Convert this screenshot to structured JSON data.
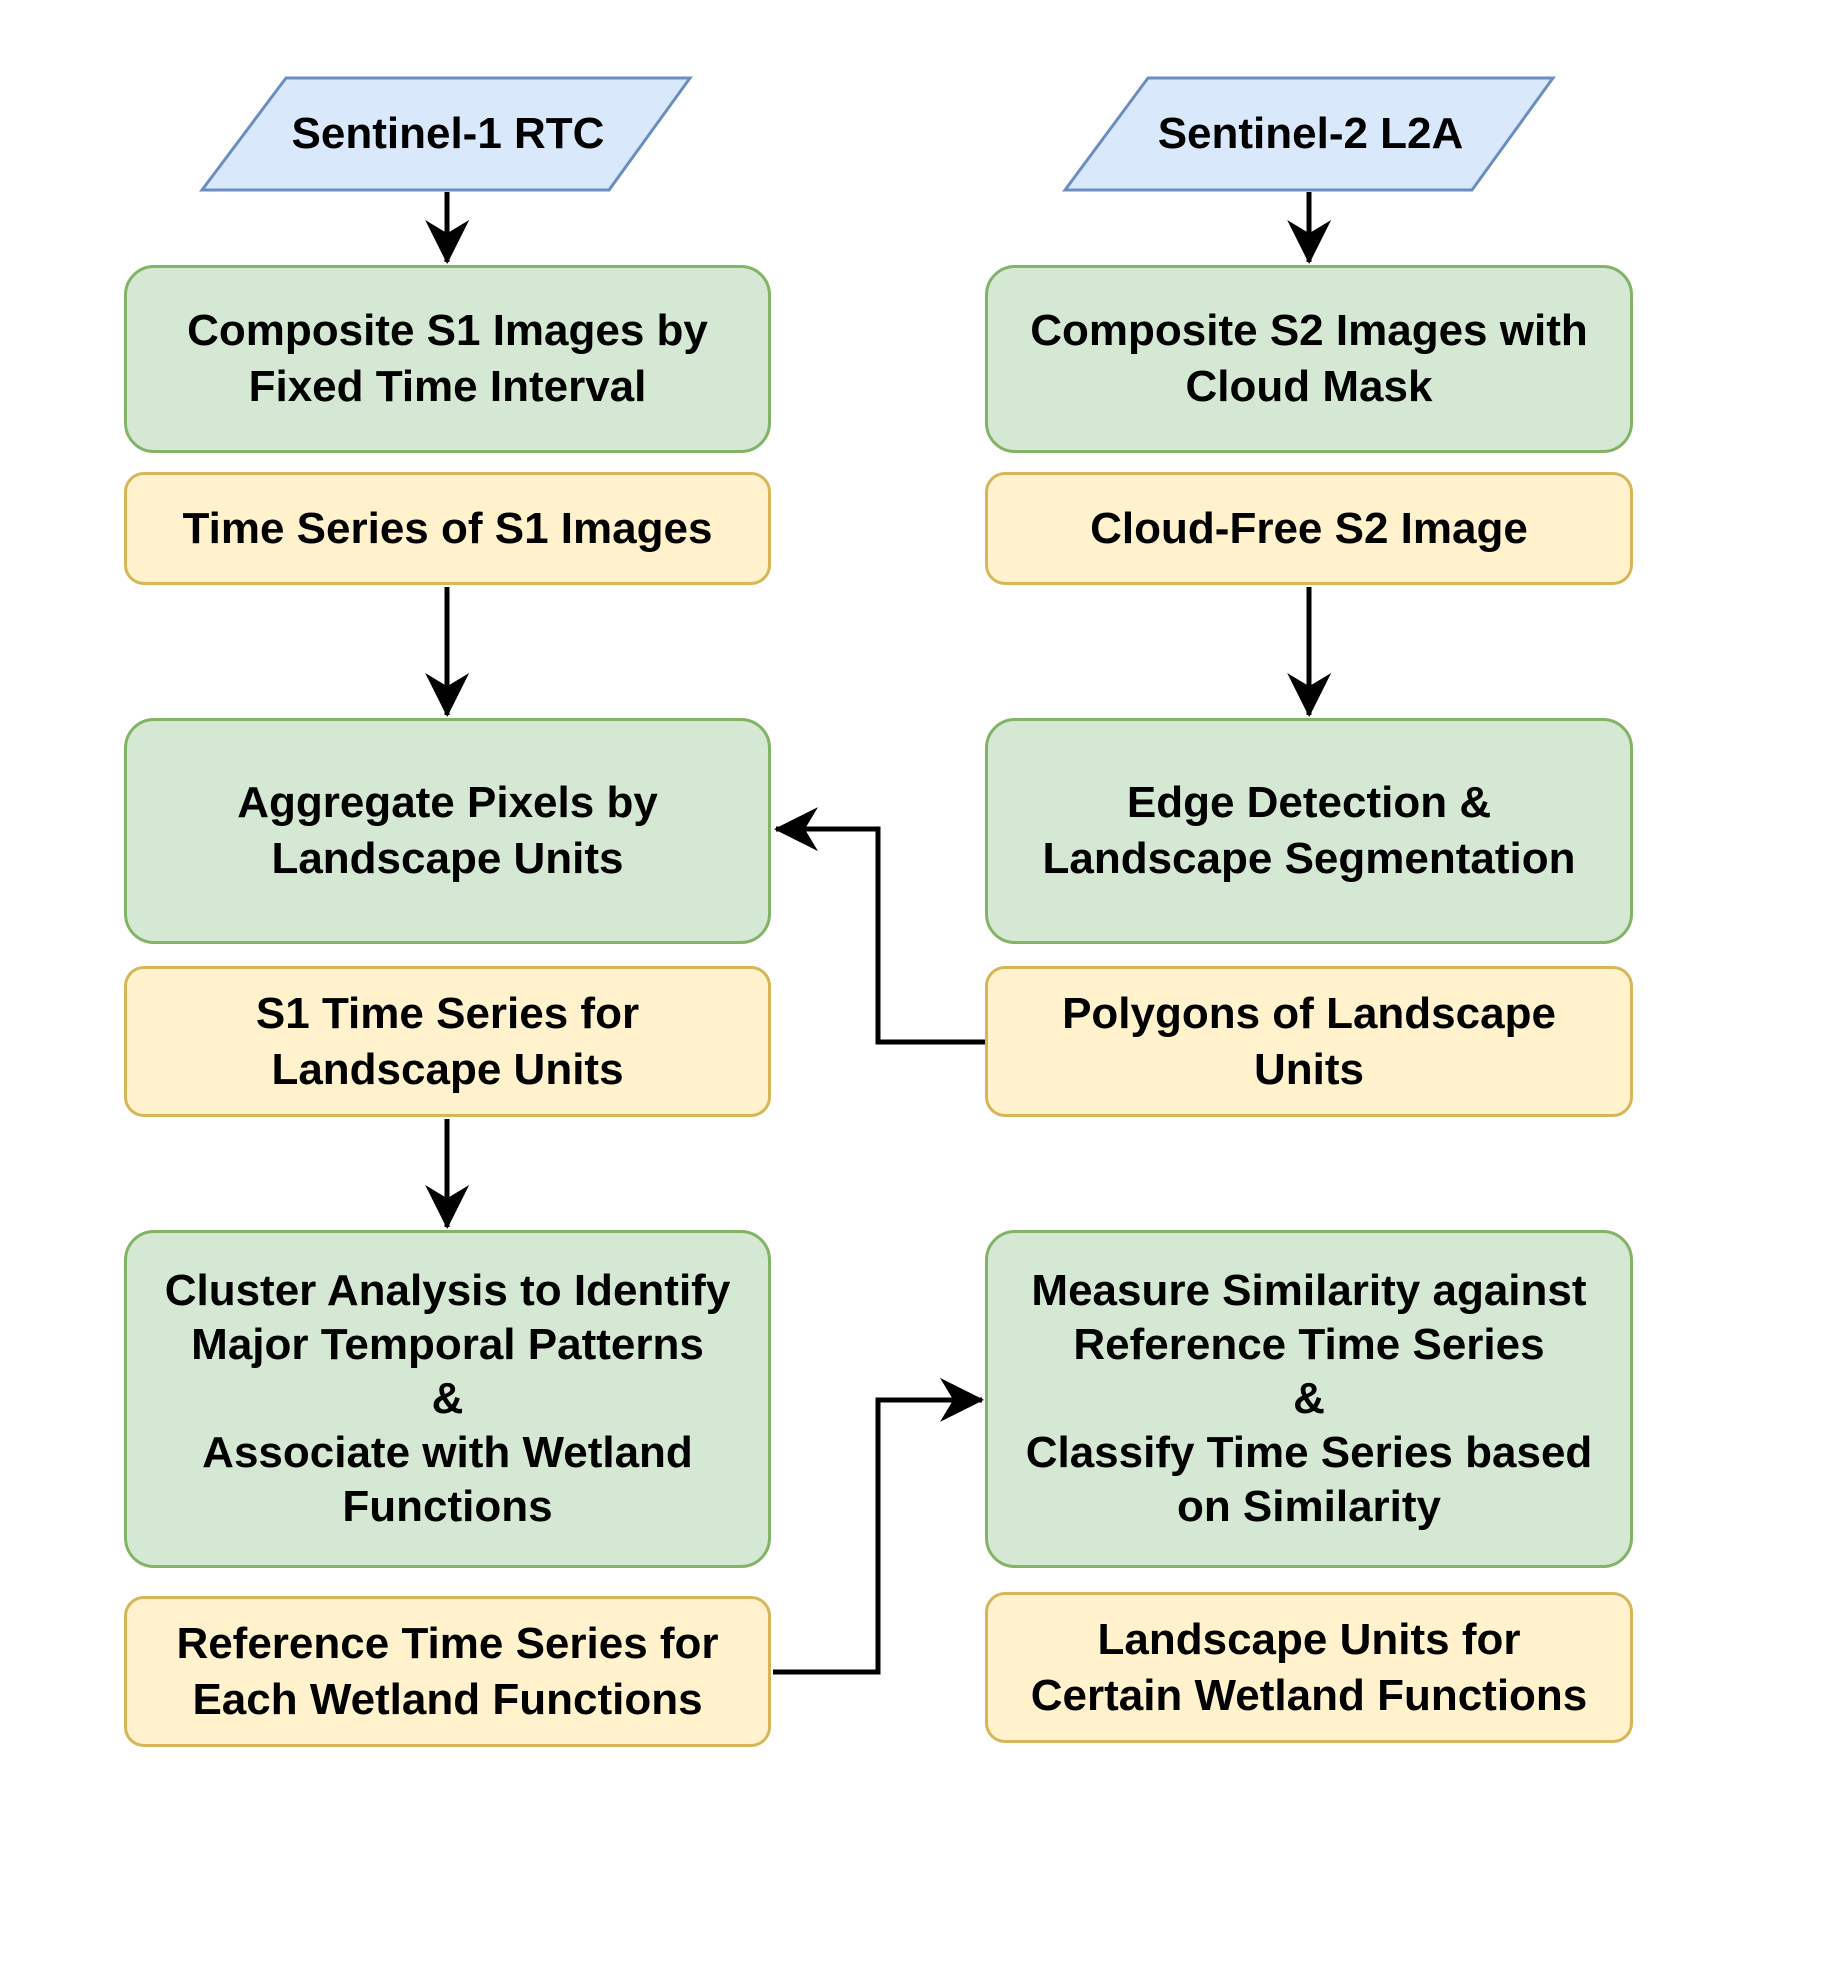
{
  "colors": {
    "input_fill": "#dae8fc",
    "input_stroke": "#6c8ebf",
    "process_fill": "#d5e8d4",
    "process_stroke": "#82b366",
    "output_fill": "#fff2cc",
    "output_stroke": "#d6b656",
    "arrow": "#000000"
  },
  "inputs": {
    "s1": "Sentinel-1 RTC",
    "s2": "Sentinel-2 L2A"
  },
  "left": {
    "process1": "Composite S1 Images by\nFixed Time Interval",
    "output1": "Time Series of S1 Images",
    "process2": "Aggregate Pixels by\nLandscape Units",
    "output2": "S1 Time Series for\nLandscape Units",
    "process3": "Cluster Analysis to Identify\nMajor Temporal Patterns\n&\nAssociate with Wetland\nFunctions",
    "output3": "Reference Time Series for\nEach Wetland Functions"
  },
  "right": {
    "process1": "Composite S2 Images with\nCloud Mask",
    "output1": "Cloud-Free S2 Image",
    "process2": "Edge Detection &\nLandscape Segmentation",
    "output2": "Polygons of Landscape\nUnits",
    "process3": "Measure Similarity against\nReference Time Series\n&\nClassify Time Series based\non Similarity",
    "output3": "Landscape Units for\nCertain Wetland Functions"
  }
}
